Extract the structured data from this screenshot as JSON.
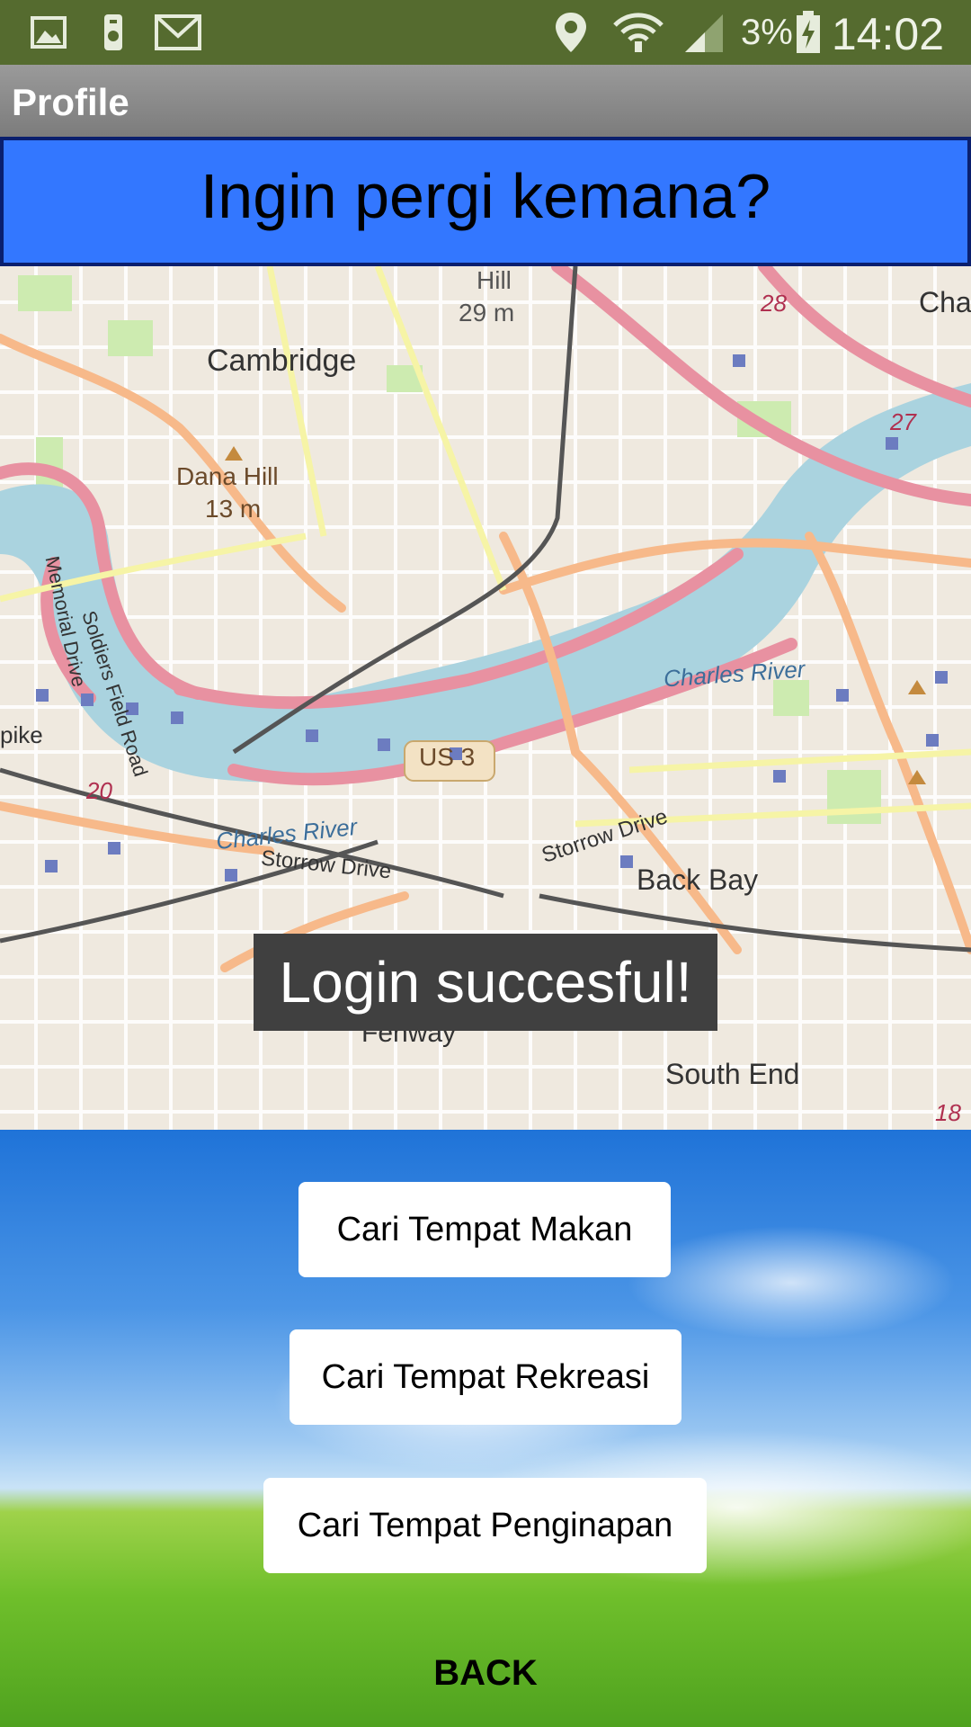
{
  "status_bar": {
    "icons": [
      "gallery-icon",
      "voicemail-icon",
      "gmail-icon",
      "location-icon",
      "wifi-icon",
      "signal-icon",
      "battery-charging-icon"
    ],
    "battery": "3%",
    "time": "14:02"
  },
  "title_bar": {
    "title": "Profile"
  },
  "banner": {
    "question": "Ingin pergi kemana?"
  },
  "map": {
    "labels": {
      "cambridge": "Cambridge",
      "dana_hill": "Dana Hill",
      "dana_hill_elev": "13 m",
      "hill": "Hill",
      "hill_elev": "29 m",
      "charles_river": "Charles River",
      "charles_river_2": "Charles River",
      "storrow_drive": "Storrow Drive",
      "storrow_drive_2": "Storrow Drive",
      "memorial_drive": "Memorial Drive",
      "soldiers_field": "Soldiers Field Road",
      "us3": "US 3",
      "back_bay": "Back Bay",
      "fenway": "Fenway",
      "south_end": "South End",
      "charle": "Charle",
      "pike": "pike",
      "route_20": "20",
      "route_27": "27",
      "route_28": "28",
      "route_18": "18"
    },
    "colors": {
      "water": "#aad3df",
      "major_road": "#f7b98a",
      "highway": "#e891a1",
      "park": "#cdebb0"
    }
  },
  "toast": {
    "message": "Login succesful!"
  },
  "buttons": {
    "makan": "Cari Tempat Makan",
    "rekreasi": "Cari Tempat Rekreasi",
    "penginapan": "Cari Tempat Penginapan",
    "back": "BACK"
  }
}
